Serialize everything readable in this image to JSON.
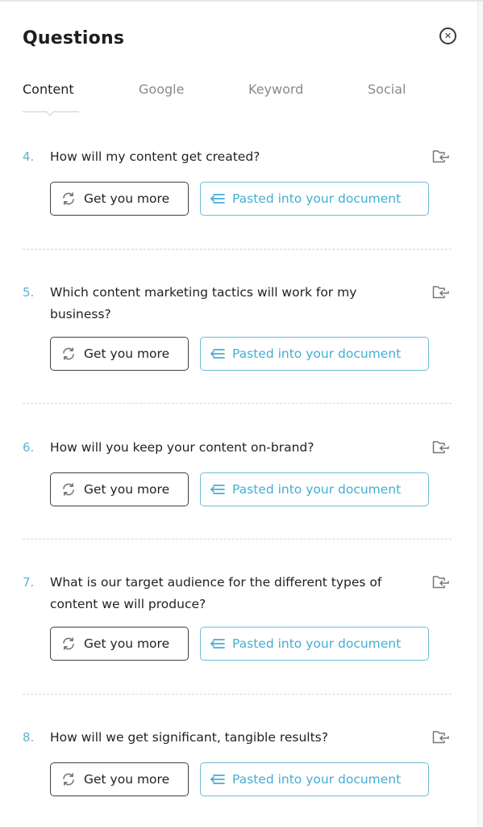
{
  "panel": {
    "title": "Questions",
    "close_icon": "close-circle-icon"
  },
  "tabs": [
    {
      "label": "Content",
      "active": true
    },
    {
      "label": "Google",
      "active": false
    },
    {
      "label": "Keyword",
      "active": false
    },
    {
      "label": "Social",
      "active": false
    }
  ],
  "colors": {
    "accent": "#44aed3",
    "number": "#5fb3d4",
    "text": "#222222",
    "button_border_dark": "#3c3f45",
    "button_border_accent": "#6cbcd6"
  },
  "questions": [
    {
      "number": "4.",
      "text": "How will my content get created?",
      "more_label": "Get you more",
      "paste_label": "Pasted into your document"
    },
    {
      "number": "5.",
      "text": "Which content marketing tactics will work for my business?",
      "more_label": "Get you more",
      "paste_label": "Pasted into your document"
    },
    {
      "number": "6.",
      "text": "How will you keep your content on-brand?",
      "more_label": "Get you more",
      "paste_label": "Pasted into your document"
    },
    {
      "number": "7.",
      "text": "What is our target audience for the different types of content we will produce?",
      "more_label": "Get you more",
      "paste_label": "Pasted into your document"
    },
    {
      "number": "8.",
      "text": "How will we get significant, tangible results?",
      "more_label": "Get you more",
      "paste_label": "Pasted into your document"
    }
  ]
}
